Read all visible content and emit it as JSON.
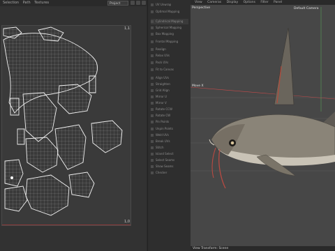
{
  "uv_editor": {
    "menu": [
      "Selection",
      "Path",
      "Textures"
    ],
    "project_select": "Project",
    "corner_top": "1,1",
    "corner_bottom": "1,0"
  },
  "tools": [
    "UV Unwrap",
    "Optimal Mapping",
    "Cylindrical Mapping",
    "Spherical Mapping",
    "Box Mapping",
    "Frontal Mapping",
    "Realign",
    "Relax UVs",
    "Pack UVs",
    "Fit to Canvas",
    "Align UVs",
    "Straighten",
    "Grid Align",
    "Mirror U",
    "Mirror V",
    "Rotate CCW",
    "Rotate CW",
    "Pin Points",
    "Unpin Points",
    "Weld UVs",
    "Break UVs",
    "Stitch",
    "Island Select",
    "Select Seams",
    "Show Seams",
    "Checker"
  ],
  "viewport": {
    "menu": [
      "View",
      "Cameras",
      "Display",
      "Options",
      "Filter",
      "Panel"
    ],
    "label": "Perspective",
    "camera": "Default Camera",
    "axis_label": "Move X",
    "status": "View Transform: Scene"
  },
  "colors": {
    "uv_background": "#3a3a3a",
    "uv_lines": "#e6e6e6",
    "viewport_bg": "#474747",
    "axis_red": "#c84a4a",
    "axis_green": "#5aa35a"
  }
}
